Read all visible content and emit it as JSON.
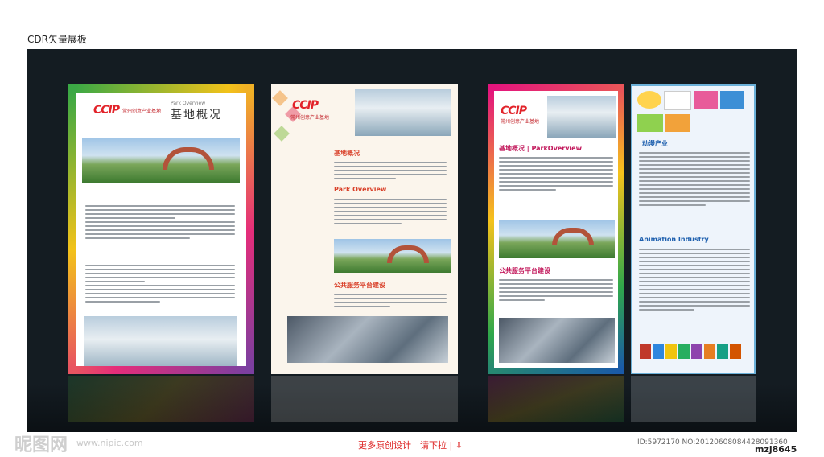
{
  "header": {
    "label": "CDR矢量展板"
  },
  "panel1": {
    "logo_en": "CCIP",
    "logo_cn": "常州创意产业基地",
    "heading_en": "Park Overview",
    "heading_cn": "基地概况"
  },
  "panel2": {
    "logo_en": "CCIP",
    "logo_cn": "常州创意产业基地",
    "section1_cn": "基地概况",
    "section1_en": "Park Overview",
    "section2_cn": "公共服务平台建设"
  },
  "panel3": {
    "logo_en": "CCIP",
    "logo_cn": "常州创意产业基地",
    "section1": "基地概况 | ParkOverview",
    "section2": "公共服务平台建设"
  },
  "panel4": {
    "section1_cn": "动漫产业",
    "section2_en": "Animation Industry"
  },
  "footer": {
    "more_link": "更多原创设计　请下拉 | ⇩",
    "watermark": "昵图网",
    "site": "www.nipic.com",
    "id_text": "ID:5972170 NO:20120608084428091360",
    "author": "mzj8645"
  },
  "colors": {
    "stage": "#141c22",
    "accent_red": "#d9412a",
    "accent_blue": "#1d5fae"
  }
}
